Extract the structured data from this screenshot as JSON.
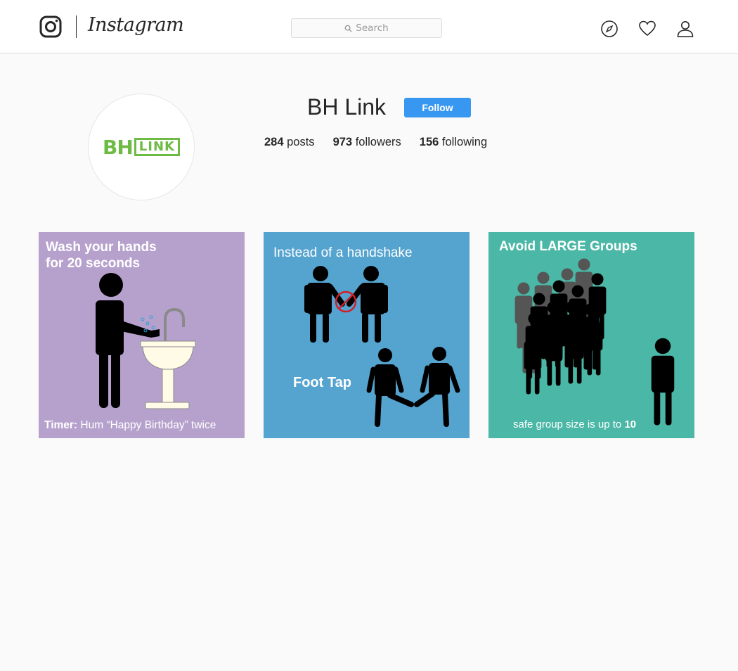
{
  "header": {
    "brand": "Instagram",
    "search": {
      "placeholder": "Search"
    },
    "icons": [
      "instagram-glyph-icon",
      "compass-icon",
      "heart-icon",
      "user-icon"
    ]
  },
  "profile": {
    "logo": {
      "part1": "BH",
      "part2": "LINK"
    },
    "username": "BH Link",
    "follow_label": "Follow",
    "stats": {
      "posts_count": "284",
      "posts_label": "posts",
      "followers_count": "973",
      "followers_label": "followers",
      "following_count": "156",
      "following_label": "following"
    }
  },
  "posts": [
    {
      "title_line1": "Wash your hands",
      "title_line2": "for 20 seconds",
      "footer_bold": "Timer:",
      "footer_text": "Hum “Happy Birthday” twice",
      "bg": "#b6a1cd"
    },
    {
      "title": "Instead of a handshake",
      "subtitle": "Foot Tap",
      "bg": "#55a3cf"
    },
    {
      "title": "Avoid LARGE Groups",
      "footer_text": "safe group size is up to",
      "footer_bold": "10",
      "bg": "#4bb7a6"
    }
  ],
  "colors": {
    "accent": "#3897f0",
    "logo_green": "#6dbb45"
  }
}
